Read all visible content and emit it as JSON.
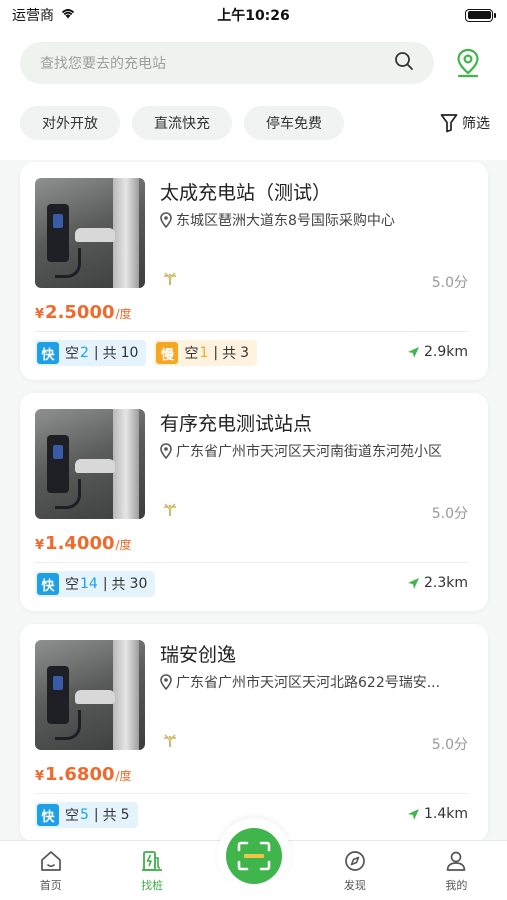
{
  "status": {
    "carrier": "运营商",
    "time": "上午10:26"
  },
  "search": {
    "placeholder": "查找您要去的充电站"
  },
  "filters": {
    "chips": [
      "对外开放",
      "直流快充",
      "停车免费"
    ],
    "filter_label": "筛选"
  },
  "stations": [
    {
      "name": "太成充电站（测试）",
      "address": "东城区琶洲大道东8号国际采购中心",
      "rating": "5.0分",
      "currency": "¥",
      "price": "2.5000",
      "unit": "/度",
      "fast": {
        "badge": "快",
        "free_label": "空",
        "free": "2",
        "sep": "|",
        "total_label": "共",
        "total": "10"
      },
      "slow": {
        "badge": "慢",
        "free_label": "空",
        "free": "1",
        "sep": "|",
        "total_label": "共",
        "total": "3"
      },
      "distance": "2.9km"
    },
    {
      "name": "有序充电测试站点",
      "address": "广东省广州市天河区天河南街道东河苑小区",
      "rating": "5.0分",
      "currency": "¥",
      "price": "1.4000",
      "unit": "/度",
      "fast": {
        "badge": "快",
        "free_label": "空",
        "free": "14",
        "sep": "|",
        "total_label": "共",
        "total": "30"
      },
      "distance": "2.3km"
    },
    {
      "name": "瑞安创逸",
      "address": "广东省广州市天河区天河北路622号瑞安...",
      "rating": "5.0分",
      "currency": "¥",
      "price": "1.6800",
      "unit": "/度",
      "fast": {
        "badge": "快",
        "free_label": "空",
        "free": "5",
        "sep": "|",
        "total_label": "共",
        "total": "5"
      },
      "distance": "1.4km"
    }
  ],
  "tabbar": {
    "items": [
      {
        "label": "首页",
        "icon": "home-icon"
      },
      {
        "label": "找桩",
        "icon": "charger-icon",
        "active": true
      },
      {
        "label": "发现",
        "icon": "compass-icon"
      },
      {
        "label": "我的",
        "icon": "user-icon"
      }
    ]
  },
  "colors": {
    "brand": "#3fb54b",
    "price": "#ef6a2c",
    "fast": "#1ea0e6",
    "slow": "#f5a623"
  }
}
